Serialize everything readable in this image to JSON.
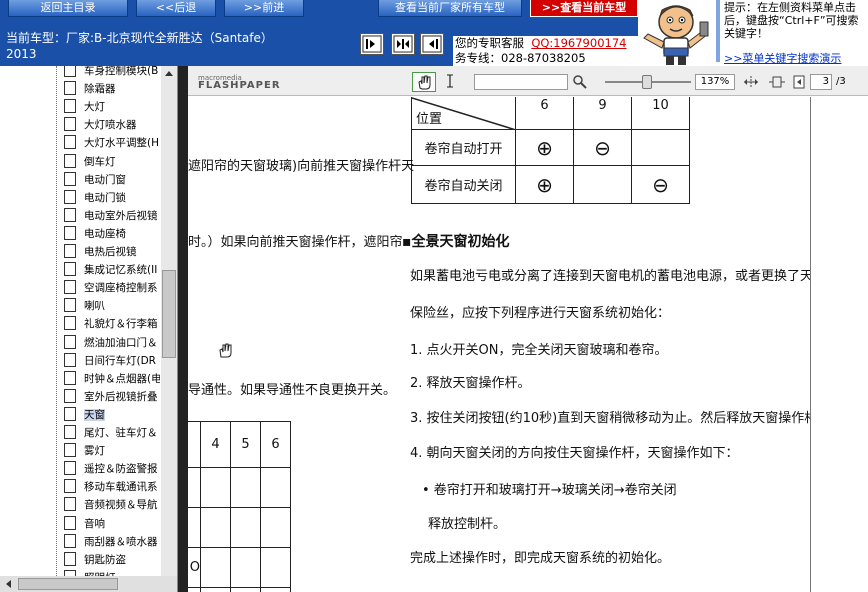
{
  "nav": {
    "home": "返回主目录",
    "back": "<<后退",
    "forward": ">>前进",
    "all_models": "查看当前厂家所有车型",
    "current_model": ">>查看当前车型"
  },
  "help": {
    "tip": "提示：在左侧资料菜单点击后，键盘按“Ctrl+F”可搜索关键字！",
    "search_link": ">>菜单关键字搜索演示"
  },
  "car": {
    "title": "当前车型：厂家:B-北京现代全新胜达（Santafe）2013"
  },
  "service": {
    "line1_label": "您的专职客服",
    "qq": "QQ:1967900174",
    "line2": "务专线：028-87038205"
  },
  "tree": {
    "items": [
      "车身控制模块(B",
      "除霜器",
      "大灯",
      "大灯喷水器",
      "大灯水平调整(H",
      "倒车灯",
      "电动门窗",
      "电动门锁",
      "电动室外后视镜",
      "电动座椅",
      "电热后视镜",
      "集成记忆系统(II",
      "空调座椅控制系",
      "喇叭",
      "礼貌灯＆行李箱",
      "燃油加油口门＆",
      "日间行车灯(DR",
      "时钟＆点烟器(电",
      "室外后视镜折叠",
      "天窗",
      "尾灯、驻车灯＆",
      "雾灯",
      "遥控＆防盗警报",
      "移动车载通讯系",
      "音频视频＆导航",
      "音响",
      "雨刮器＆喷水器",
      "钥匙防盗",
      "照明灯"
    ],
    "selected": "天窗"
  },
  "viewer": {
    "logo_small": "macromedia",
    "logo_big": "FLASHPAPER",
    "zoom": "137%",
    "page": "3",
    "page_total": "/3"
  },
  "document": {
    "table1_header_left": "位置",
    "table1_cols": [
      "6",
      "9",
      "10"
    ],
    "table1_rows": [
      {
        "label": "卷帘自动打开",
        "cells": [
          "⊕",
          "⊖",
          ""
        ]
      },
      {
        "label": "卷帘自动关闭",
        "cells": [
          "⊕",
          "",
          "⊖"
        ]
      }
    ],
    "left_text1": "遮阳帘的天窗玻璃)向前推天窗操作杆天",
    "left_text2": "时。）如果向前推天窗操作杆，遮阳帘",
    "left_text3": "导通性。如果导通性不良更换开关。",
    "small_table_cols": [
      "4",
      "5",
      "6"
    ],
    "small_table_mark": "O",
    "heading": "▪全景天窗初始化",
    "para1": "如果蓄电池亏电或分离了连接到天窗电机的蓄电池电源，或者更换了天窗电机",
    "para2": "保险丝，应按下列程序进行天窗系统初始化：",
    "step1": "1. 点火开关ON，完全关闭天窗玻璃和卷帘。",
    "step2": "2. 释放天窗操作杆。",
    "step3": "3. 按住关闭按钮(约10秒)直到天窗稍微移动为止。然后释放天窗操作杆。",
    "step4": "4. 朝向天窗关闭的方向按住天窗操作杆，天窗操作如下：",
    "bullet1": "• 卷帘打开和玻璃打开→玻璃关闭→卷帘关闭",
    "bullet2": "释放控制杆。",
    "conclusion": "完成上述操作时，即完成天窗系统的初始化。"
  }
}
